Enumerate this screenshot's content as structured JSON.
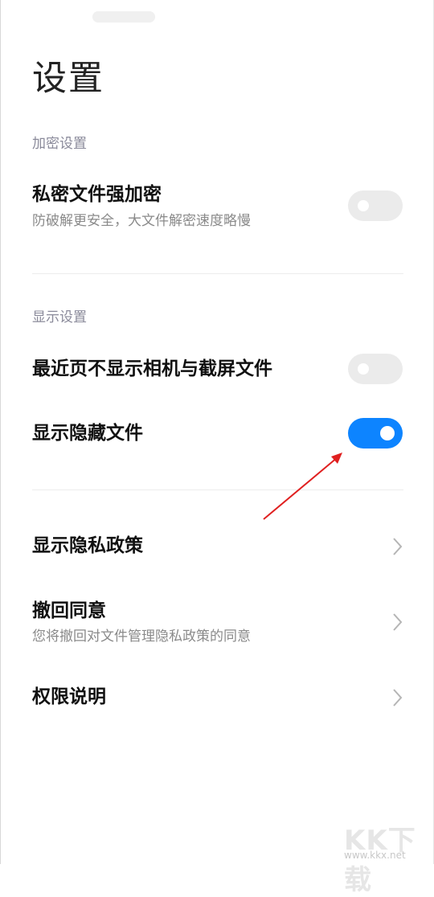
{
  "header": {
    "title": "设置"
  },
  "sections": {
    "encryption": {
      "label": "加密设置",
      "items": [
        {
          "title": "私密文件强加密",
          "subtitle": "防破解更安全，大文件解密速度略慢",
          "toggle": "off"
        }
      ]
    },
    "display": {
      "label": "显示设置",
      "items": [
        {
          "title": "最近页不显示相机与截屏文件",
          "toggle": "off"
        },
        {
          "title": "显示隐藏文件",
          "toggle": "on"
        }
      ]
    },
    "links": {
      "items": [
        {
          "title": "显示隐私政策"
        },
        {
          "title": "撤回同意",
          "subtitle": "您将撤回对文件管理隐私政策的同意"
        },
        {
          "title": "权限说明"
        }
      ]
    }
  },
  "colors": {
    "accent": "#0d84ff",
    "annotation_arrow": "#e02020",
    "section_label": "#8a8a9a"
  },
  "watermark": {
    "brand": "KK下载",
    "url": "www.kkx.net"
  }
}
